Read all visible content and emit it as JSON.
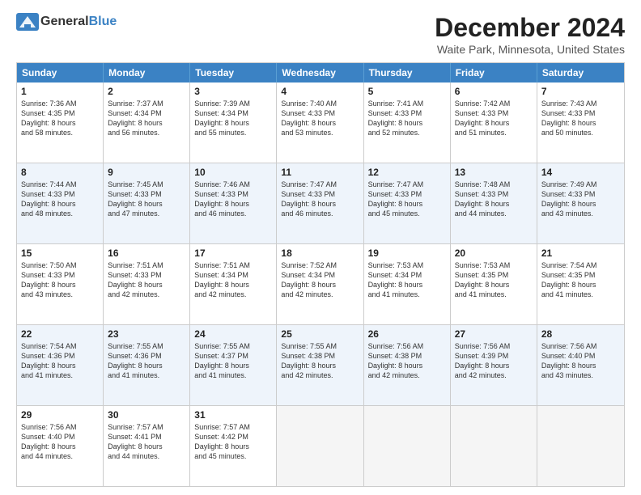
{
  "logo": {
    "general": "General",
    "blue": "Blue"
  },
  "title": "December 2024",
  "subtitle": "Waite Park, Minnesota, United States",
  "days": [
    "Sunday",
    "Monday",
    "Tuesday",
    "Wednesday",
    "Thursday",
    "Friday",
    "Saturday"
  ],
  "rows": [
    [
      {
        "day": "1",
        "lines": [
          "Sunrise: 7:36 AM",
          "Sunset: 4:35 PM",
          "Daylight: 8 hours",
          "and 58 minutes."
        ]
      },
      {
        "day": "2",
        "lines": [
          "Sunrise: 7:37 AM",
          "Sunset: 4:34 PM",
          "Daylight: 8 hours",
          "and 56 minutes."
        ]
      },
      {
        "day": "3",
        "lines": [
          "Sunrise: 7:39 AM",
          "Sunset: 4:34 PM",
          "Daylight: 8 hours",
          "and 55 minutes."
        ]
      },
      {
        "day": "4",
        "lines": [
          "Sunrise: 7:40 AM",
          "Sunset: 4:33 PM",
          "Daylight: 8 hours",
          "and 53 minutes."
        ]
      },
      {
        "day": "5",
        "lines": [
          "Sunrise: 7:41 AM",
          "Sunset: 4:33 PM",
          "Daylight: 8 hours",
          "and 52 minutes."
        ]
      },
      {
        "day": "6",
        "lines": [
          "Sunrise: 7:42 AM",
          "Sunset: 4:33 PM",
          "Daylight: 8 hours",
          "and 51 minutes."
        ]
      },
      {
        "day": "7",
        "lines": [
          "Sunrise: 7:43 AM",
          "Sunset: 4:33 PM",
          "Daylight: 8 hours",
          "and 50 minutes."
        ]
      }
    ],
    [
      {
        "day": "8",
        "lines": [
          "Sunrise: 7:44 AM",
          "Sunset: 4:33 PM",
          "Daylight: 8 hours",
          "and 48 minutes."
        ]
      },
      {
        "day": "9",
        "lines": [
          "Sunrise: 7:45 AM",
          "Sunset: 4:33 PM",
          "Daylight: 8 hours",
          "and 47 minutes."
        ]
      },
      {
        "day": "10",
        "lines": [
          "Sunrise: 7:46 AM",
          "Sunset: 4:33 PM",
          "Daylight: 8 hours",
          "and 46 minutes."
        ]
      },
      {
        "day": "11",
        "lines": [
          "Sunrise: 7:47 AM",
          "Sunset: 4:33 PM",
          "Daylight: 8 hours",
          "and 46 minutes."
        ]
      },
      {
        "day": "12",
        "lines": [
          "Sunrise: 7:47 AM",
          "Sunset: 4:33 PM",
          "Daylight: 8 hours",
          "and 45 minutes."
        ]
      },
      {
        "day": "13",
        "lines": [
          "Sunrise: 7:48 AM",
          "Sunset: 4:33 PM",
          "Daylight: 8 hours",
          "and 44 minutes."
        ]
      },
      {
        "day": "14",
        "lines": [
          "Sunrise: 7:49 AM",
          "Sunset: 4:33 PM",
          "Daylight: 8 hours",
          "and 43 minutes."
        ]
      }
    ],
    [
      {
        "day": "15",
        "lines": [
          "Sunrise: 7:50 AM",
          "Sunset: 4:33 PM",
          "Daylight: 8 hours",
          "and 43 minutes."
        ]
      },
      {
        "day": "16",
        "lines": [
          "Sunrise: 7:51 AM",
          "Sunset: 4:33 PM",
          "Daylight: 8 hours",
          "and 42 minutes."
        ]
      },
      {
        "day": "17",
        "lines": [
          "Sunrise: 7:51 AM",
          "Sunset: 4:34 PM",
          "Daylight: 8 hours",
          "and 42 minutes."
        ]
      },
      {
        "day": "18",
        "lines": [
          "Sunrise: 7:52 AM",
          "Sunset: 4:34 PM",
          "Daylight: 8 hours",
          "and 42 minutes."
        ]
      },
      {
        "day": "19",
        "lines": [
          "Sunrise: 7:53 AM",
          "Sunset: 4:34 PM",
          "Daylight: 8 hours",
          "and 41 minutes."
        ]
      },
      {
        "day": "20",
        "lines": [
          "Sunrise: 7:53 AM",
          "Sunset: 4:35 PM",
          "Daylight: 8 hours",
          "and 41 minutes."
        ]
      },
      {
        "day": "21",
        "lines": [
          "Sunrise: 7:54 AM",
          "Sunset: 4:35 PM",
          "Daylight: 8 hours",
          "and 41 minutes."
        ]
      }
    ],
    [
      {
        "day": "22",
        "lines": [
          "Sunrise: 7:54 AM",
          "Sunset: 4:36 PM",
          "Daylight: 8 hours",
          "and 41 minutes."
        ]
      },
      {
        "day": "23",
        "lines": [
          "Sunrise: 7:55 AM",
          "Sunset: 4:36 PM",
          "Daylight: 8 hours",
          "and 41 minutes."
        ]
      },
      {
        "day": "24",
        "lines": [
          "Sunrise: 7:55 AM",
          "Sunset: 4:37 PM",
          "Daylight: 8 hours",
          "and 41 minutes."
        ]
      },
      {
        "day": "25",
        "lines": [
          "Sunrise: 7:55 AM",
          "Sunset: 4:38 PM",
          "Daylight: 8 hours",
          "and 42 minutes."
        ]
      },
      {
        "day": "26",
        "lines": [
          "Sunrise: 7:56 AM",
          "Sunset: 4:38 PM",
          "Daylight: 8 hours",
          "and 42 minutes."
        ]
      },
      {
        "day": "27",
        "lines": [
          "Sunrise: 7:56 AM",
          "Sunset: 4:39 PM",
          "Daylight: 8 hours",
          "and 42 minutes."
        ]
      },
      {
        "day": "28",
        "lines": [
          "Sunrise: 7:56 AM",
          "Sunset: 4:40 PM",
          "Daylight: 8 hours",
          "and 43 minutes."
        ]
      }
    ],
    [
      {
        "day": "29",
        "lines": [
          "Sunrise: 7:56 AM",
          "Sunset: 4:40 PM",
          "Daylight: 8 hours",
          "and 44 minutes."
        ]
      },
      {
        "day": "30",
        "lines": [
          "Sunrise: 7:57 AM",
          "Sunset: 4:41 PM",
          "Daylight: 8 hours",
          "and 44 minutes."
        ]
      },
      {
        "day": "31",
        "lines": [
          "Sunrise: 7:57 AM",
          "Sunset: 4:42 PM",
          "Daylight: 8 hours",
          "and 45 minutes."
        ]
      },
      null,
      null,
      null,
      null
    ]
  ]
}
